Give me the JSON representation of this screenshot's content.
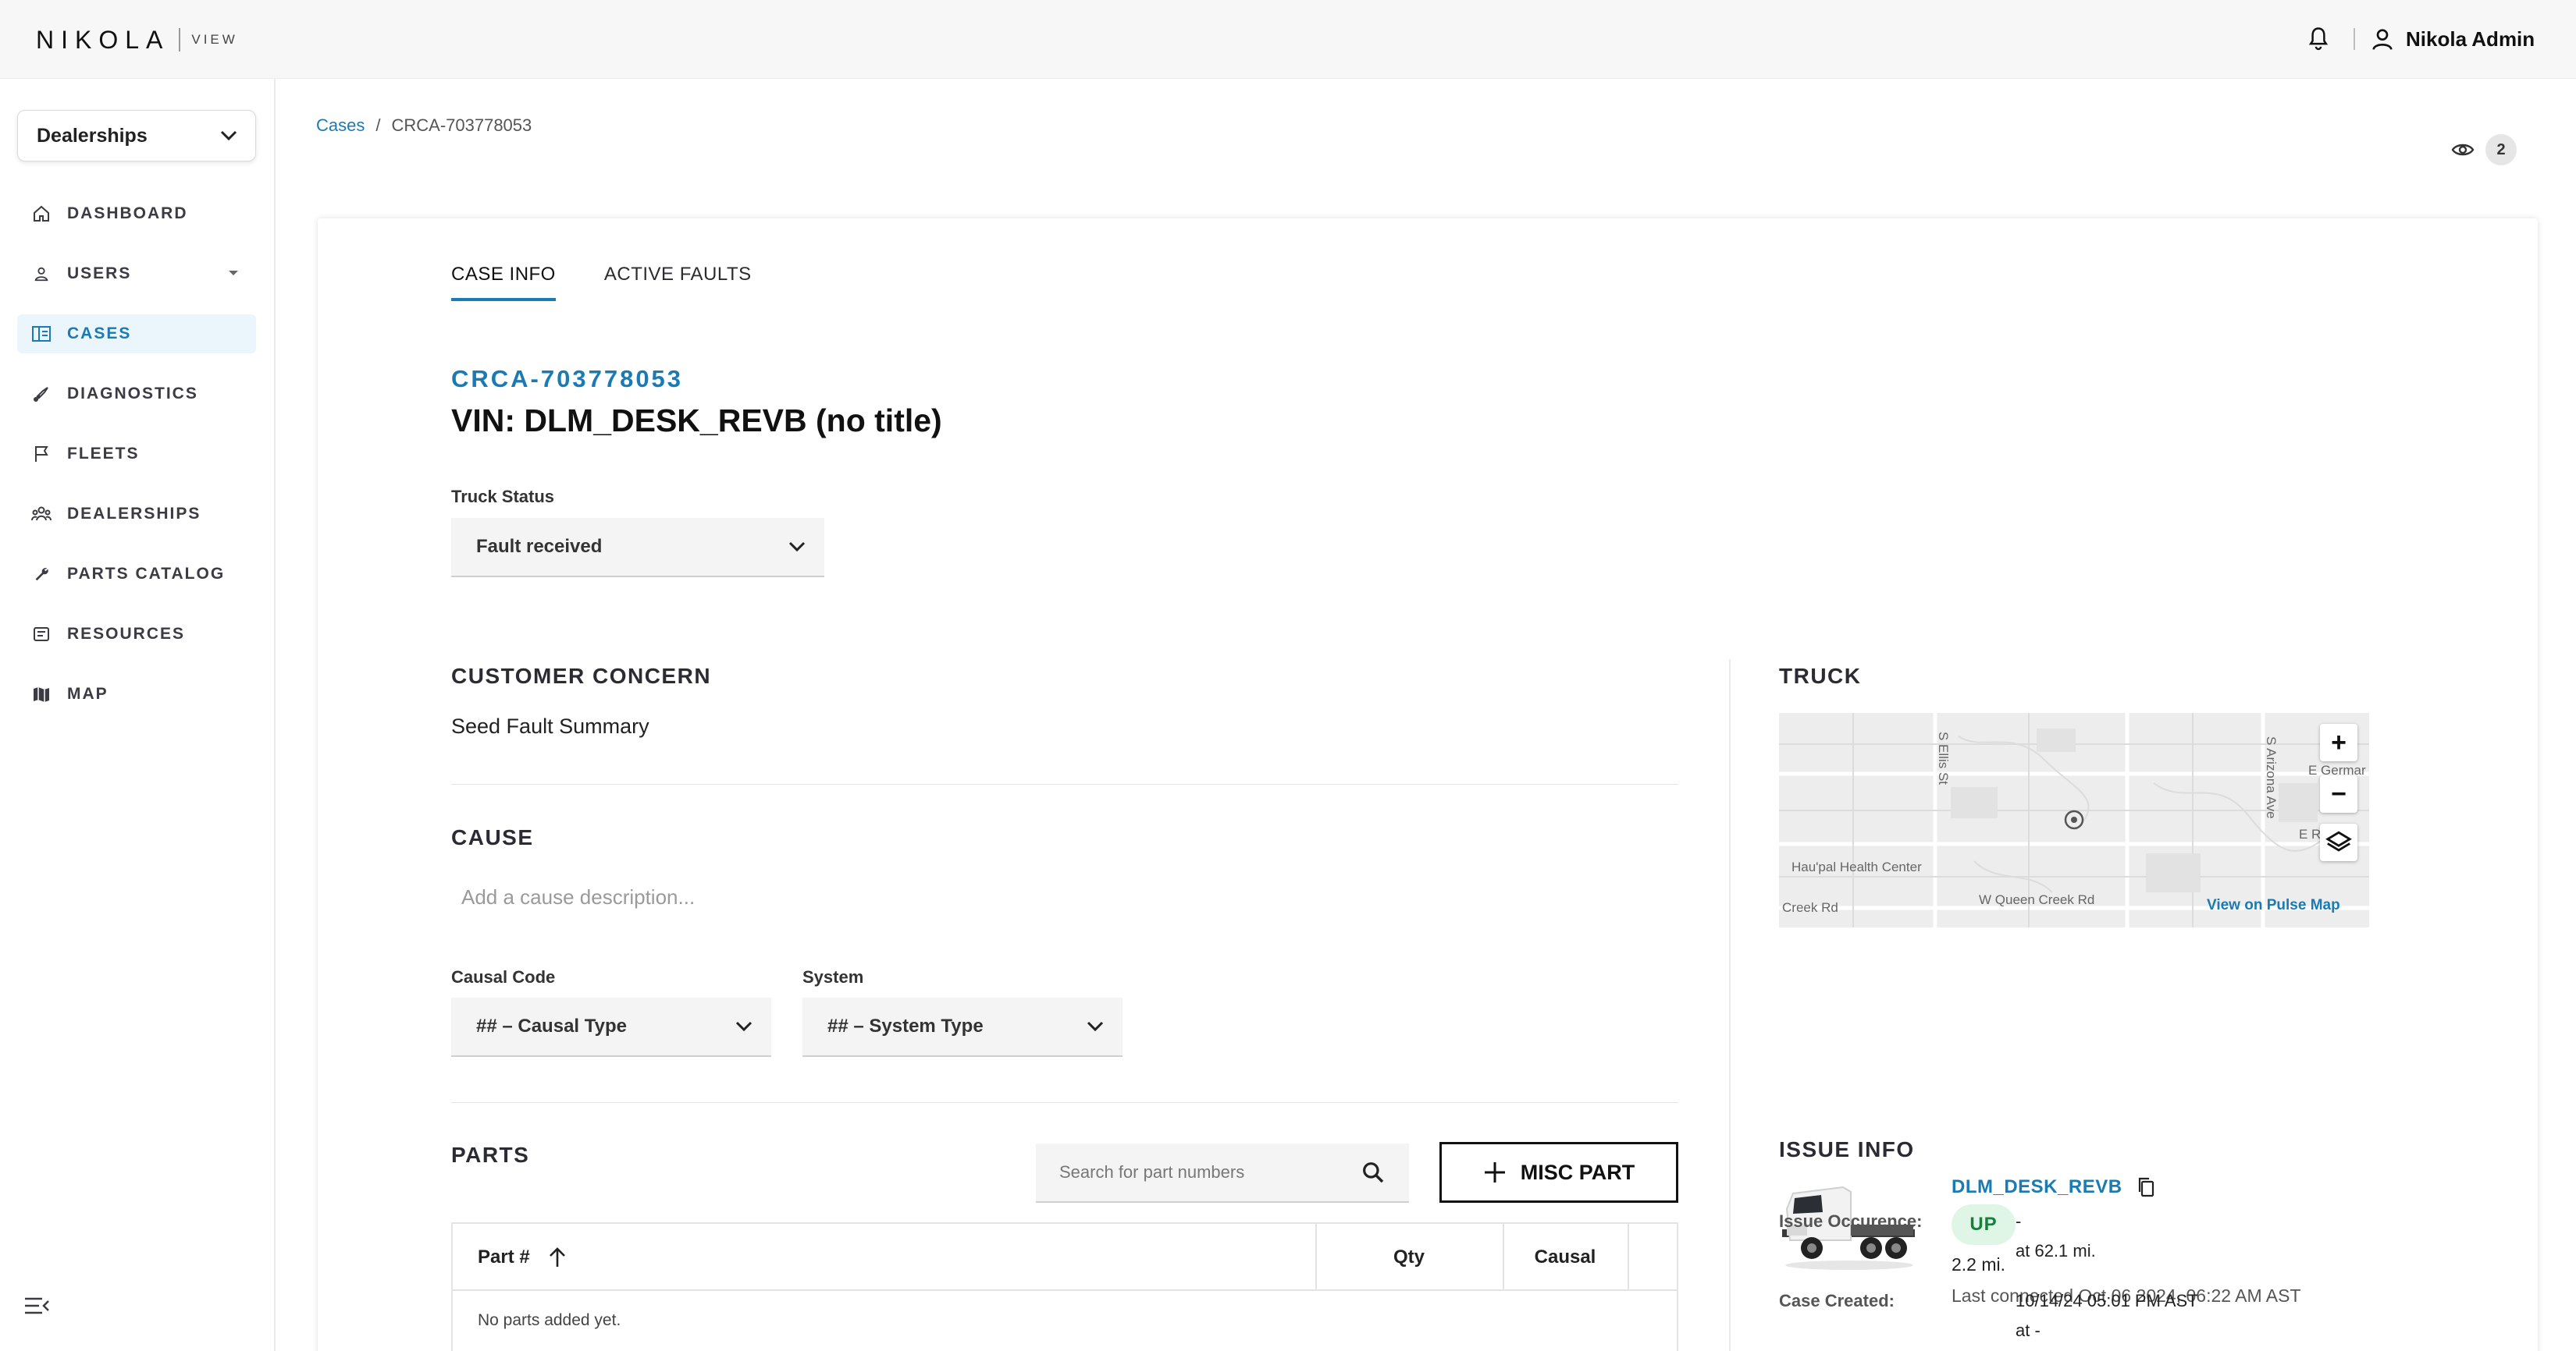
{
  "header": {
    "logo_word": "NIKOLA",
    "logo_sub": "VIEW",
    "user_name": "Nikola Admin",
    "icons": {
      "bell": "bell-icon",
      "user": "user-icon"
    }
  },
  "sidebar": {
    "dealer_select": "Dealerships",
    "items": [
      {
        "label": "DASHBOARD",
        "icon": "home-icon"
      },
      {
        "label": "USERS",
        "icon": "user-icon",
        "has_caret": true
      },
      {
        "label": "CASES",
        "icon": "cases-icon",
        "active": true
      },
      {
        "label": "DIAGNOSTICS",
        "icon": "diagnostics-icon"
      },
      {
        "label": "FLEETS",
        "icon": "flag-icon"
      },
      {
        "label": "DEALERSHIPS",
        "icon": "group-icon"
      },
      {
        "label": "PARTS CATALOG",
        "icon": "wrench-icon"
      },
      {
        "label": "RESOURCES",
        "icon": "resources-icon"
      },
      {
        "label": "MAP",
        "icon": "map-icon"
      }
    ]
  },
  "breadcrumb": {
    "root": "Cases",
    "sep": "/",
    "current": "CRCA-703778053"
  },
  "watchers": {
    "count": "2"
  },
  "tabs": [
    {
      "label": "CASE INFO",
      "active": true
    },
    {
      "label": "ACTIVE FAULTS",
      "active": false
    }
  ],
  "case": {
    "id": "CRCA-703778053",
    "vin_title": "VIN: DLM_DESK_REVB (no title)",
    "truck_status_label": "Truck Status",
    "truck_status_value": "Fault received"
  },
  "customer_concern": {
    "title": "CUSTOMER CONCERN",
    "text": "Seed Fault Summary"
  },
  "cause": {
    "title": "CAUSE",
    "placeholder": "Add a cause description...",
    "causal_code_label": "Causal Code",
    "causal_code_value": "## – Causal Type",
    "system_label": "System",
    "system_value": "## – System Type"
  },
  "parts": {
    "title": "PARTS",
    "search_placeholder": "Search for part numbers",
    "misc_button": "MISC PART",
    "columns": [
      "Part #",
      "Qty",
      "Causal"
    ],
    "empty_text": "No parts added yet."
  },
  "truck": {
    "title": "TRUCK",
    "map": {
      "zoom_in": "+",
      "zoom_out": "−",
      "labels": [
        "S Ellis St",
        "S Arizona Ave",
        "E Germar",
        "E Ri",
        "Hau'pal Health Center",
        "Creek Rd",
        "W Queen Creek Rd"
      ],
      "pulse_link": "View on Pulse Map"
    },
    "vin": "DLM_DESK_REVB",
    "status": "UP",
    "distance": "2.2 mi.",
    "last_connected": "Last connected Oct 06 2024, 06:22 AM AST"
  },
  "issue_info": {
    "title": "ISSUE INFO",
    "occurrence_label": "Issue Occurence:",
    "occurrence_value": "-",
    "occurrence_at": "at 62.1 mi.",
    "created_label": "Case Created:",
    "created_value": "10/14/24 05:01 PM AST",
    "created_at": "at -"
  },
  "colors": {
    "accent": "#1a7ab3",
    "up_badge_bg": "#dff5e5",
    "up_badge_fg": "#16803c"
  }
}
